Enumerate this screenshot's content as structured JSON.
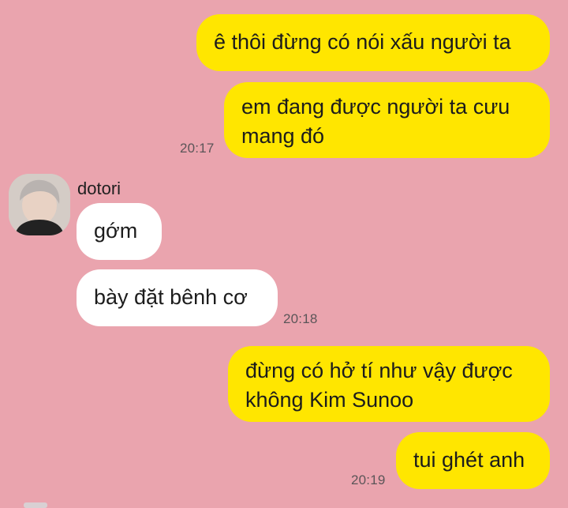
{
  "colors": {
    "background": "#EAA4AE",
    "outgoing_bubble": "#FFE600",
    "incoming_bubble": "#FFFFFF",
    "timestamp_text": "#5b5558"
  },
  "contact": {
    "name": "dotori",
    "avatar_icon": "user-avatar-photo"
  },
  "messages": [
    {
      "direction": "outgoing",
      "text": "ê thôi đừng có nói xấu người ta"
    },
    {
      "direction": "outgoing",
      "text": "em đang được người ta cưu mang đó",
      "time": "20:17"
    },
    {
      "direction": "incoming",
      "text": "gớm"
    },
    {
      "direction": "incoming",
      "text": "bày đặt bênh cơ",
      "time": "20:18"
    },
    {
      "direction": "outgoing",
      "text": "đừng có hở tí như vậy được không Kim Sunoo"
    },
    {
      "direction": "outgoing",
      "text": "tui ghét anh",
      "time": "20:19"
    }
  ]
}
